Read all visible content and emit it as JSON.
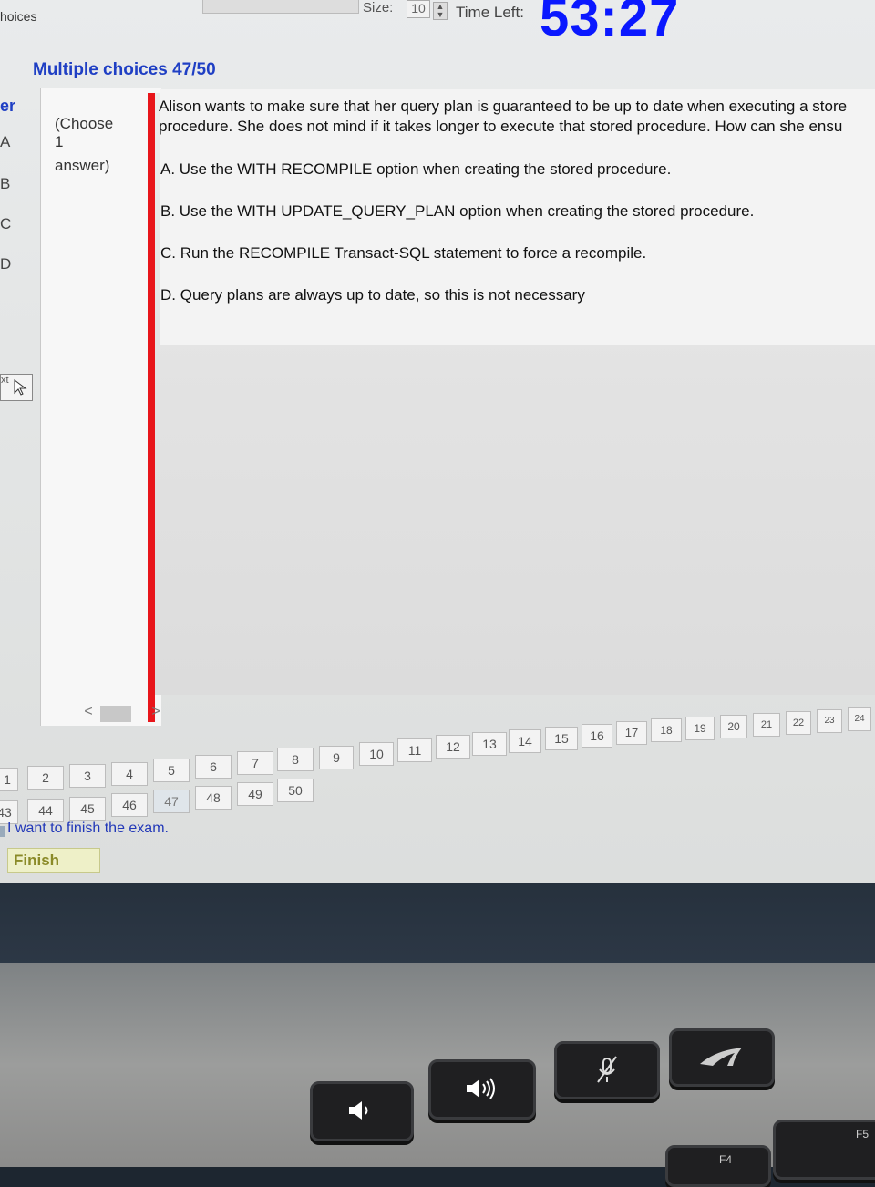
{
  "top": {
    "tab_label": "hoices",
    "size_label": "Size:",
    "size_value": "10",
    "time_left_label": "Time Left:",
    "timer_value": "53:27"
  },
  "section_title": "Multiple choices 47/50",
  "sidebar": {
    "letters": [
      "er",
      "A",
      "B",
      "C",
      "D"
    ],
    "cursor_label": "xt"
  },
  "question": {
    "instruction_line1": "(Choose",
    "instruction_line2": "1",
    "instruction_line3": "answer)",
    "text": "Alison wants to make sure that her query plan is guaranteed to be up to date when executing a store procedure. She does not mind if it takes longer to execute that stored procedure. How can she ensu",
    "options": [
      "A. Use the WITH RECOMPILE option when creating the stored procedure.",
      "B. Use the WITH UPDATE_QUERY_PLAN option when creating the stored procedure.",
      "C. Run the RECOMPILE Transact-SQL statement to force a recompile.",
      "D. Query plans are always up to date, so this is not necessary"
    ]
  },
  "scroll": {
    "left": "<",
    "right": ">"
  },
  "nav": {
    "row1": [
      "1",
      "2",
      "3",
      "4",
      "5",
      "6",
      "7",
      "8",
      "9",
      "10",
      "11",
      "12",
      "13",
      "14",
      "15",
      "16",
      "17",
      "18",
      "19",
      "20",
      "21",
      "22",
      "23",
      "24"
    ],
    "row2": [
      "43",
      "44",
      "45",
      "46",
      "47",
      "48",
      "49",
      "50"
    ],
    "finish_note": "I want to finish the exam.",
    "finish_label": "Finish"
  },
  "keys": {
    "f5": "F5",
    "f4": "F4"
  }
}
